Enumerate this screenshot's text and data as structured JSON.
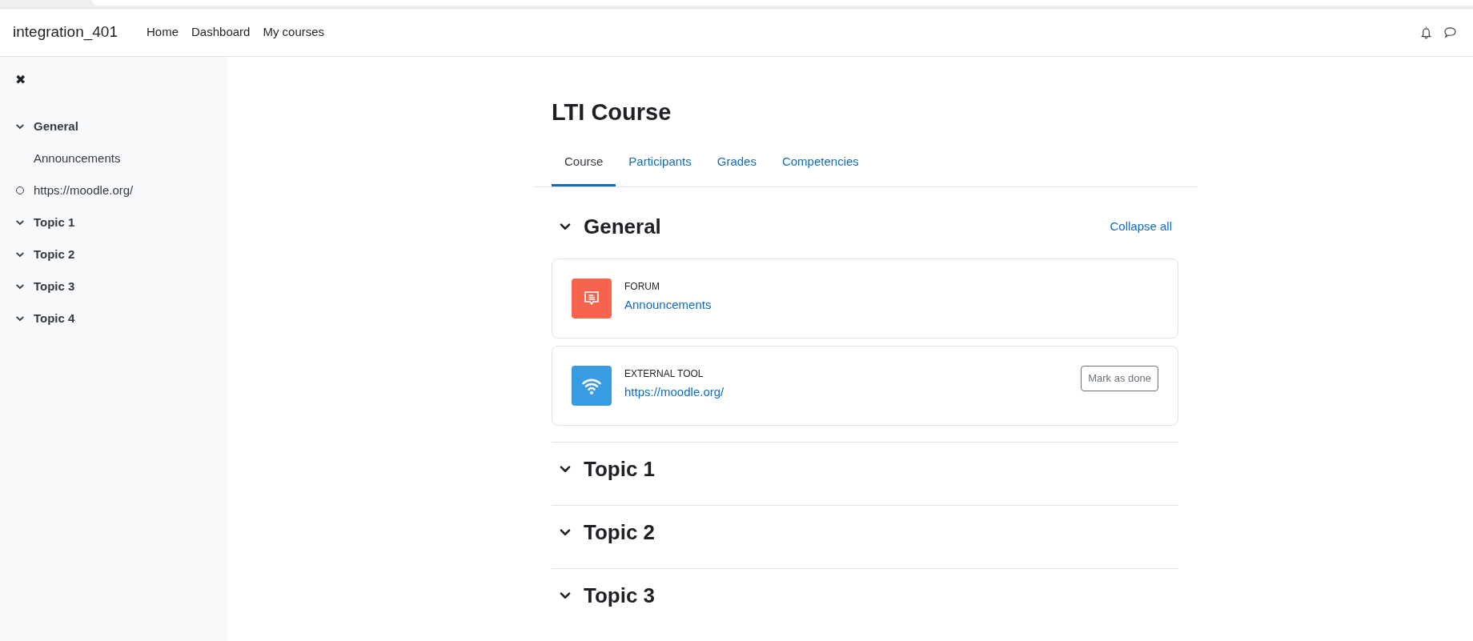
{
  "navbar": {
    "site_name": "integration_401",
    "links": [
      {
        "label": "Home"
      },
      {
        "label": "Dashboard"
      },
      {
        "label": "My courses"
      }
    ]
  },
  "sidebar": {
    "close_symbol": "✖",
    "sections": [
      {
        "title": "General",
        "expanded": true,
        "children": [
          {
            "label": "Announcements",
            "kind": "plain"
          },
          {
            "label": "https://moodle.org/",
            "kind": "completion"
          }
        ]
      },
      {
        "title": "Topic 1",
        "expanded": true
      },
      {
        "title": "Topic 2",
        "expanded": true
      },
      {
        "title": "Topic 3",
        "expanded": true
      },
      {
        "title": "Topic 4",
        "expanded": true
      }
    ]
  },
  "course": {
    "title": "LTI Course",
    "tabs": [
      {
        "label": "Course",
        "selected": true
      },
      {
        "label": "Participants",
        "selected": false
      },
      {
        "label": "Grades",
        "selected": false
      },
      {
        "label": "Competencies",
        "selected": false
      }
    ],
    "collapse_all": "Collapse all",
    "sections": [
      {
        "title": "General",
        "expanded": true,
        "activities": [
          {
            "type": "FORUM",
            "name": "Announcements",
            "kind": "forum"
          },
          {
            "type": "EXTERNAL TOOL",
            "name": "https://moodle.org/",
            "kind": "lti",
            "action": "Mark as done"
          }
        ]
      },
      {
        "title": "Topic 1",
        "expanded": true
      },
      {
        "title": "Topic 2",
        "expanded": true
      },
      {
        "title": "Topic 3",
        "expanded": true
      }
    ]
  }
}
